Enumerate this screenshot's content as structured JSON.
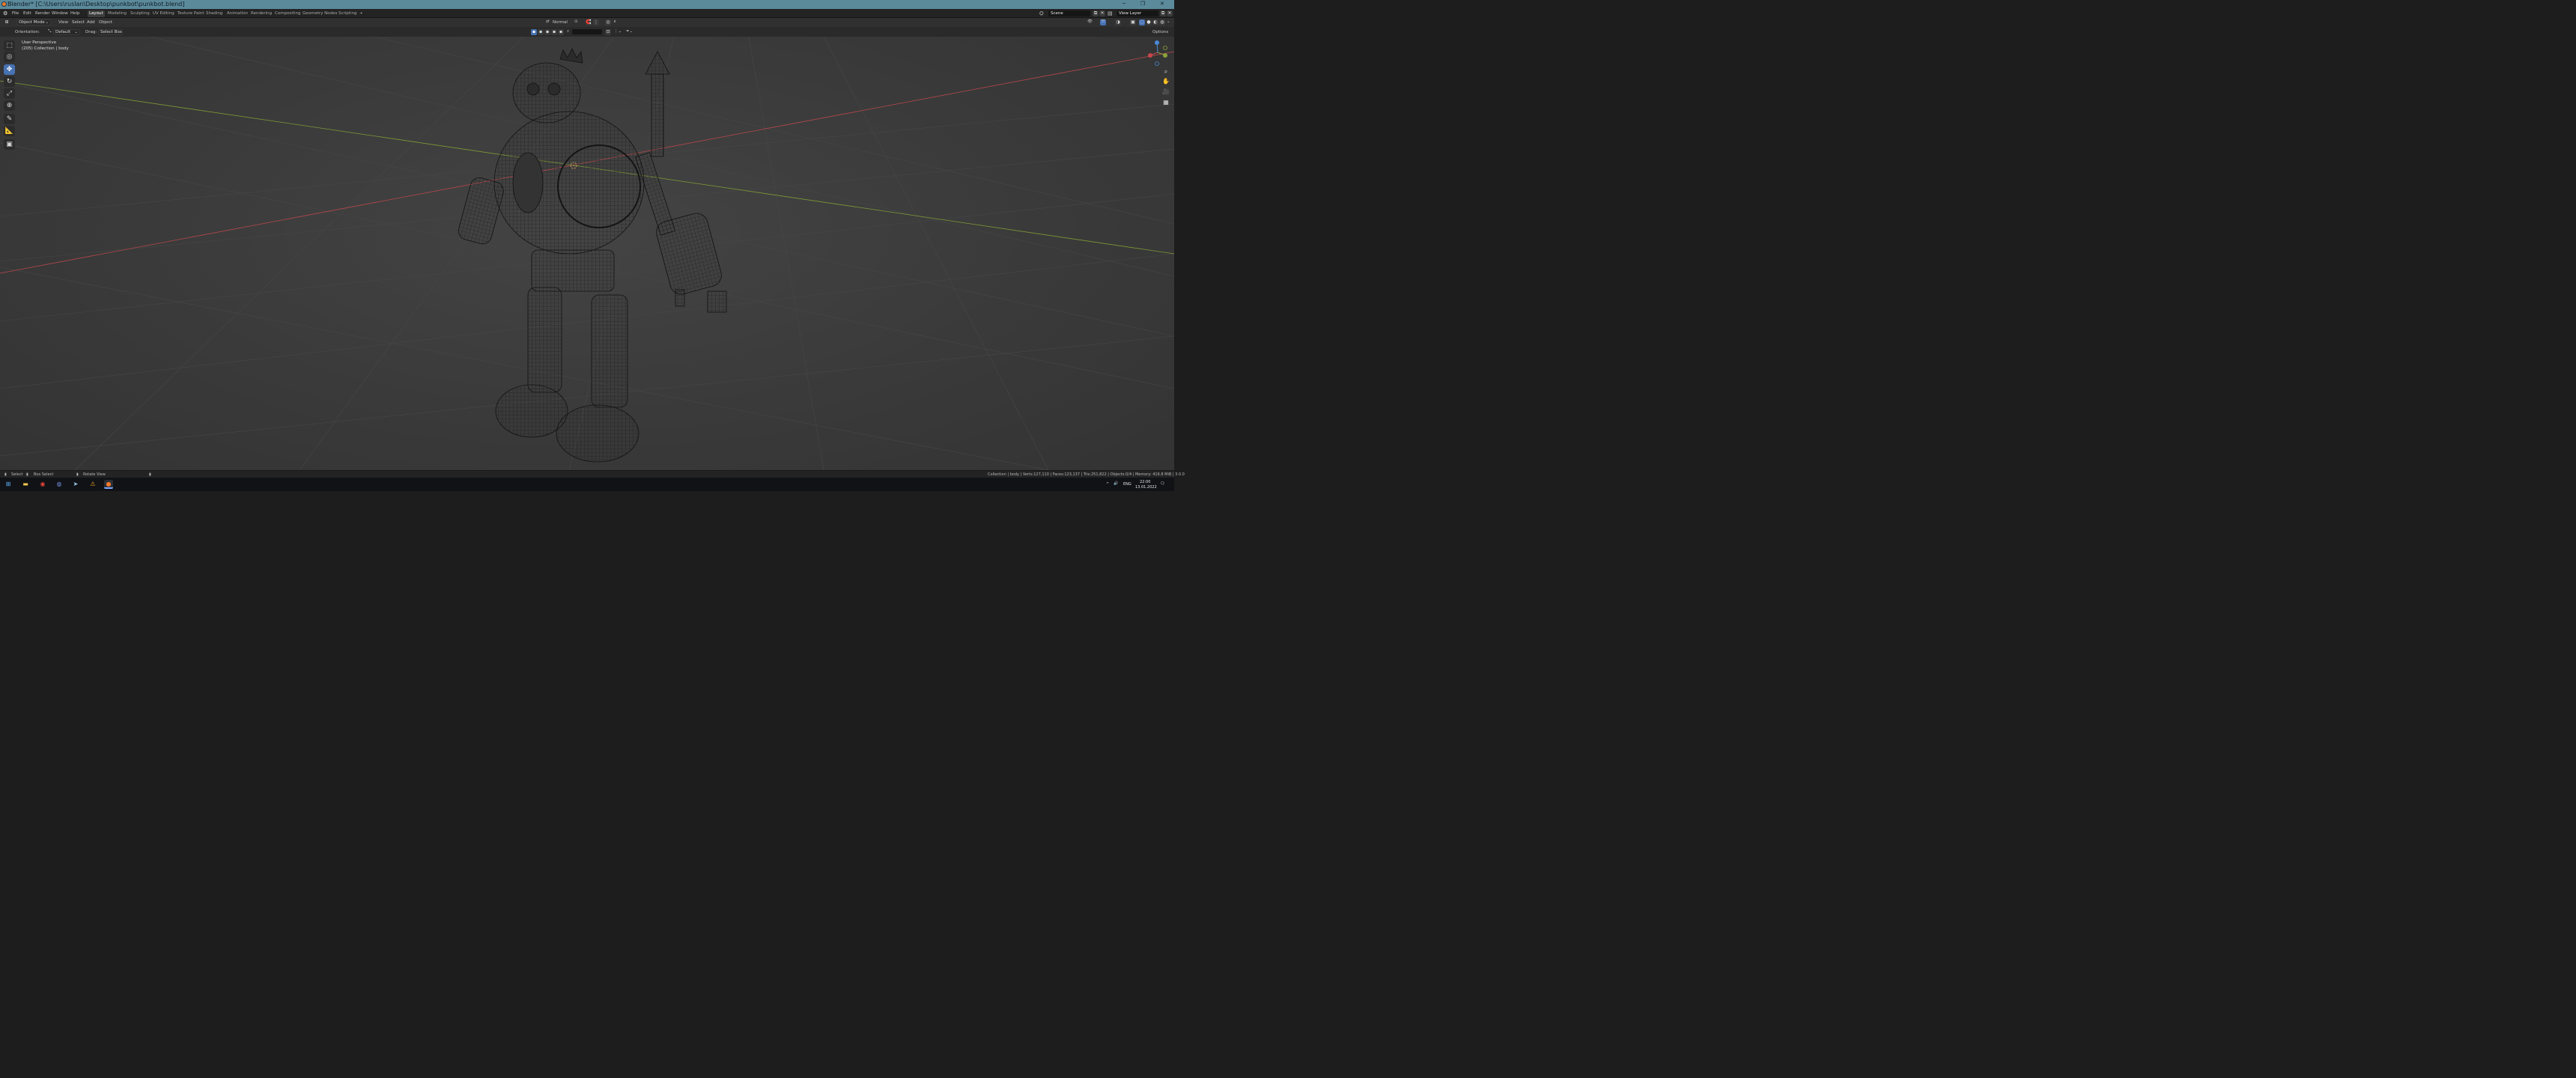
{
  "window": {
    "title": "Blender* [C:\\Users\\ruslan\\Desktop\\punkbot\\punkbot.blend]",
    "minimize": "─",
    "maximize": "❐",
    "close": "✕"
  },
  "menus": [
    "File",
    "Edit",
    "Render",
    "Window",
    "Help"
  ],
  "workspaces": [
    {
      "label": "Layout",
      "active": true
    },
    {
      "label": "Modeling"
    },
    {
      "label": "Sculpting"
    },
    {
      "label": "UV Editing"
    },
    {
      "label": "Texture Paint"
    },
    {
      "label": "Shading"
    },
    {
      "label": "Animation"
    },
    {
      "label": "Rendering"
    },
    {
      "label": "Compositing"
    },
    {
      "label": "Geometry Nodes"
    },
    {
      "label": "Scripting"
    },
    {
      "label": "+"
    }
  ],
  "scene": {
    "name": "Scene",
    "view_layer": "View Layer"
  },
  "header": {
    "mode": "Object Mode",
    "menu": [
      "View",
      "Select",
      "Add",
      "Object"
    ],
    "transform_orientation": "Normal",
    "options": "Options"
  },
  "tool_settings": {
    "orientation_label": "Orientation:",
    "orientation_value": "Default",
    "drag_label": "Drag:",
    "drag_value": "Select Box"
  },
  "viewport": {
    "perspective": "User Perspective",
    "collection": "(205) Collection | body"
  },
  "tools": [
    "select-box",
    "cursor",
    "move",
    "rotate",
    "scale",
    "transform",
    "annotate",
    "measure",
    "add-cube"
  ],
  "status": {
    "select": "Select",
    "box_select": "Box Select",
    "rotate_view": "Rotate View",
    "stats": "Collection | body | Verts:127,110 | Faces:123,137 | Tris:251,822 | Objects:0/4 | Memory: 416.8 MiB | 3.0.0"
  },
  "taskbar": {
    "lang": "ENG",
    "time": "22:00",
    "date": "13.01.2022"
  },
  "colors": {
    "accent": "#4772b3",
    "titlebar": "#5b8a9b",
    "x_axis": "#c8474c",
    "y_axis": "#8aa33a",
    "z_axis": "#4a8ad6"
  }
}
